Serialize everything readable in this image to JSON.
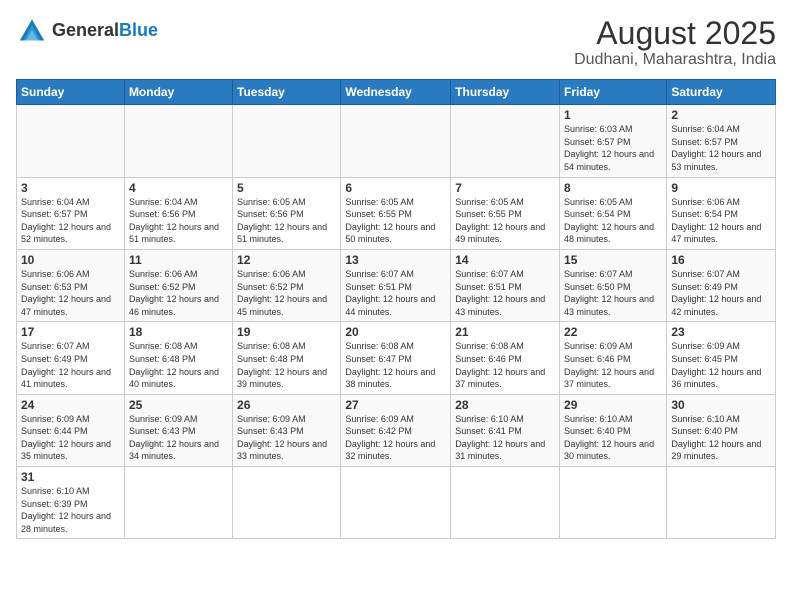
{
  "header": {
    "logo_general": "General",
    "logo_blue": "Blue",
    "title": "August 2025",
    "subtitle": "Dudhani, Maharashtra, India"
  },
  "days_of_week": [
    "Sunday",
    "Monday",
    "Tuesday",
    "Wednesday",
    "Thursday",
    "Friday",
    "Saturday"
  ],
  "weeks": [
    [
      {
        "num": "",
        "info": ""
      },
      {
        "num": "",
        "info": ""
      },
      {
        "num": "",
        "info": ""
      },
      {
        "num": "",
        "info": ""
      },
      {
        "num": "",
        "info": ""
      },
      {
        "num": "1",
        "info": "Sunrise: 6:03 AM\nSunset: 6:57 PM\nDaylight: 12 hours and 54 minutes."
      },
      {
        "num": "2",
        "info": "Sunrise: 6:04 AM\nSunset: 6:57 PM\nDaylight: 12 hours and 53 minutes."
      }
    ],
    [
      {
        "num": "3",
        "info": "Sunrise: 6:04 AM\nSunset: 6:57 PM\nDaylight: 12 hours and 52 minutes."
      },
      {
        "num": "4",
        "info": "Sunrise: 6:04 AM\nSunset: 6:56 PM\nDaylight: 12 hours and 51 minutes."
      },
      {
        "num": "5",
        "info": "Sunrise: 6:05 AM\nSunset: 6:56 PM\nDaylight: 12 hours and 51 minutes."
      },
      {
        "num": "6",
        "info": "Sunrise: 6:05 AM\nSunset: 6:55 PM\nDaylight: 12 hours and 50 minutes."
      },
      {
        "num": "7",
        "info": "Sunrise: 6:05 AM\nSunset: 6:55 PM\nDaylight: 12 hours and 49 minutes."
      },
      {
        "num": "8",
        "info": "Sunrise: 6:05 AM\nSunset: 6:54 PM\nDaylight: 12 hours and 48 minutes."
      },
      {
        "num": "9",
        "info": "Sunrise: 6:06 AM\nSunset: 6:54 PM\nDaylight: 12 hours and 47 minutes."
      }
    ],
    [
      {
        "num": "10",
        "info": "Sunrise: 6:06 AM\nSunset: 6:53 PM\nDaylight: 12 hours and 47 minutes."
      },
      {
        "num": "11",
        "info": "Sunrise: 6:06 AM\nSunset: 6:52 PM\nDaylight: 12 hours and 46 minutes."
      },
      {
        "num": "12",
        "info": "Sunrise: 6:06 AM\nSunset: 6:52 PM\nDaylight: 12 hours and 45 minutes."
      },
      {
        "num": "13",
        "info": "Sunrise: 6:07 AM\nSunset: 6:51 PM\nDaylight: 12 hours and 44 minutes."
      },
      {
        "num": "14",
        "info": "Sunrise: 6:07 AM\nSunset: 6:51 PM\nDaylight: 12 hours and 43 minutes."
      },
      {
        "num": "15",
        "info": "Sunrise: 6:07 AM\nSunset: 6:50 PM\nDaylight: 12 hours and 43 minutes."
      },
      {
        "num": "16",
        "info": "Sunrise: 6:07 AM\nSunset: 6:49 PM\nDaylight: 12 hours and 42 minutes."
      }
    ],
    [
      {
        "num": "17",
        "info": "Sunrise: 6:07 AM\nSunset: 6:49 PM\nDaylight: 12 hours and 41 minutes."
      },
      {
        "num": "18",
        "info": "Sunrise: 6:08 AM\nSunset: 6:48 PM\nDaylight: 12 hours and 40 minutes."
      },
      {
        "num": "19",
        "info": "Sunrise: 6:08 AM\nSunset: 6:48 PM\nDaylight: 12 hours and 39 minutes."
      },
      {
        "num": "20",
        "info": "Sunrise: 6:08 AM\nSunset: 6:47 PM\nDaylight: 12 hours and 38 minutes."
      },
      {
        "num": "21",
        "info": "Sunrise: 6:08 AM\nSunset: 6:46 PM\nDaylight: 12 hours and 37 minutes."
      },
      {
        "num": "22",
        "info": "Sunrise: 6:09 AM\nSunset: 6:46 PM\nDaylight: 12 hours and 37 minutes."
      },
      {
        "num": "23",
        "info": "Sunrise: 6:09 AM\nSunset: 6:45 PM\nDaylight: 12 hours and 36 minutes."
      }
    ],
    [
      {
        "num": "24",
        "info": "Sunrise: 6:09 AM\nSunset: 6:44 PM\nDaylight: 12 hours and 35 minutes."
      },
      {
        "num": "25",
        "info": "Sunrise: 6:09 AM\nSunset: 6:43 PM\nDaylight: 12 hours and 34 minutes."
      },
      {
        "num": "26",
        "info": "Sunrise: 6:09 AM\nSunset: 6:43 PM\nDaylight: 12 hours and 33 minutes."
      },
      {
        "num": "27",
        "info": "Sunrise: 6:09 AM\nSunset: 6:42 PM\nDaylight: 12 hours and 32 minutes."
      },
      {
        "num": "28",
        "info": "Sunrise: 6:10 AM\nSunset: 6:41 PM\nDaylight: 12 hours and 31 minutes."
      },
      {
        "num": "29",
        "info": "Sunrise: 6:10 AM\nSunset: 6:40 PM\nDaylight: 12 hours and 30 minutes."
      },
      {
        "num": "30",
        "info": "Sunrise: 6:10 AM\nSunset: 6:40 PM\nDaylight: 12 hours and 29 minutes."
      }
    ],
    [
      {
        "num": "31",
        "info": "Sunrise: 6:10 AM\nSunset: 6:39 PM\nDaylight: 12 hours and 28 minutes."
      },
      {
        "num": "",
        "info": ""
      },
      {
        "num": "",
        "info": ""
      },
      {
        "num": "",
        "info": ""
      },
      {
        "num": "",
        "info": ""
      },
      {
        "num": "",
        "info": ""
      },
      {
        "num": "",
        "info": ""
      }
    ]
  ]
}
